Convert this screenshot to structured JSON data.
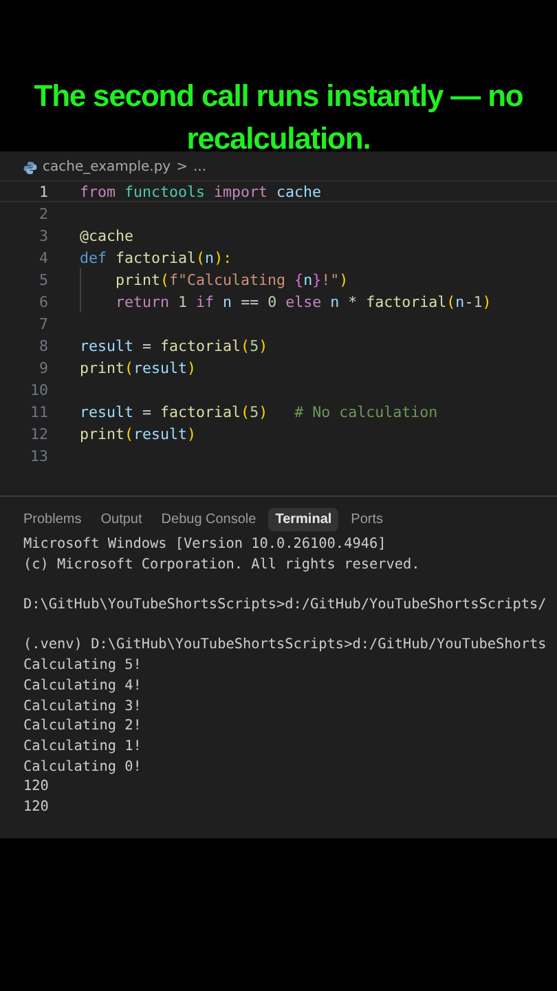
{
  "caption": "The second call runs instantly — no recalculation.",
  "breadcrumb": {
    "file": "cache_example.py",
    "separator": ">",
    "more": "..."
  },
  "editor": {
    "lines": [
      {
        "number": "1",
        "current": true,
        "tokens": [
          {
            "text": "from",
            "kind": "keyword"
          },
          {
            "text": " functools",
            "kind": "module"
          },
          {
            "text": " import",
            "kind": "keyword"
          },
          {
            "text": " cache",
            "kind": "variable"
          }
        ]
      },
      {
        "number": "2",
        "current": false
      },
      {
        "number": "3",
        "current": false,
        "tokens": [
          {
            "text": "@cache",
            "kind": "decorator"
          }
        ]
      },
      {
        "number": "4",
        "current": false,
        "tokens": [
          {
            "text": "def",
            "kind": "storage"
          },
          {
            "text": " factorial",
            "kind": "function"
          },
          {
            "text": "(",
            "kind": "paren"
          },
          {
            "text": "n",
            "kind": "variable"
          },
          {
            "text": "):",
            "kind": "paren"
          }
        ],
        "children": [
          {
            "number": "5",
            "current": false,
            "tokens": [
              {
                "text": "print",
                "kind": "function"
              },
              {
                "text": "(",
                "kind": "paren"
              },
              {
                "text": "f\"Calculating ",
                "kind": "string"
              },
              {
                "text": "{",
                "kind": "paren2"
              },
              {
                "text": "n",
                "kind": "variable"
              },
              {
                "text": "}",
                "kind": "paren2"
              },
              {
                "text": "!\"",
                "kind": "string"
              },
              {
                "text": ")",
                "kind": "paren"
              }
            ]
          },
          {
            "number": "6",
            "current": false,
            "tokens": [
              {
                "text": "return",
                "kind": "keyword"
              },
              {
                "text": " 1",
                "kind": "number"
              },
              {
                "text": " if",
                "kind": "keyword"
              },
              {
                "text": " n",
                "kind": "variable"
              },
              {
                "text": " == "
              },
              {
                "text": "0",
                "kind": "number"
              },
              {
                "text": " else",
                "kind": "keyword"
              },
              {
                "text": " n",
                "kind": "variable"
              },
              {
                "text": " * "
              },
              {
                "text": "factorial",
                "kind": "function"
              },
              {
                "text": "(",
                "kind": "paren"
              },
              {
                "text": "n",
                "kind": "variable"
              },
              {
                "text": "-"
              },
              {
                "text": "1",
                "kind": "number"
              },
              {
                "text": ")",
                "kind": "paren"
              }
            ]
          }
        ]
      },
      {
        "number": "7",
        "current": false
      },
      {
        "number": "8",
        "current": false,
        "tokens": [
          {
            "text": "result",
            "kind": "variable"
          },
          {
            "text": " = "
          },
          {
            "text": "factorial",
            "kind": "function"
          },
          {
            "text": "(",
            "kind": "paren"
          },
          {
            "text": "5",
            "kind": "number"
          },
          {
            "text": ")",
            "kind": "paren"
          }
        ]
      },
      {
        "number": "9",
        "current": false,
        "tokens": [
          {
            "text": "print",
            "kind": "function"
          },
          {
            "text": "(",
            "kind": "paren"
          },
          {
            "text": "result",
            "kind": "variable"
          },
          {
            "text": ")",
            "kind": "paren"
          }
        ]
      },
      {
        "number": "10",
        "current": false
      },
      {
        "number": "11",
        "current": false,
        "tokens": [
          {
            "text": "result",
            "kind": "variable"
          },
          {
            "text": " = "
          },
          {
            "text": "factorial",
            "kind": "function"
          },
          {
            "text": "(",
            "kind": "paren"
          },
          {
            "text": "5",
            "kind": "number"
          },
          {
            "text": ")",
            "kind": "paren"
          },
          {
            "text": "   # No calculation",
            "kind": "comment"
          }
        ]
      },
      {
        "number": "12",
        "current": false,
        "tokens": [
          {
            "text": "print",
            "kind": "function"
          },
          {
            "text": "(",
            "kind": "paren"
          },
          {
            "text": "result",
            "kind": "variable"
          },
          {
            "text": ")",
            "kind": "paren"
          }
        ]
      },
      {
        "number": "13",
        "current": false
      }
    ]
  },
  "panel": {
    "tabs": [
      {
        "label": "Problems",
        "selected": false
      },
      {
        "label": "Output",
        "selected": false
      },
      {
        "label": "Debug Console",
        "selected": false
      },
      {
        "label": "Terminal",
        "selected": true
      },
      {
        "label": "Ports",
        "selected": false
      }
    ],
    "terminal": {
      "blocks": [
        [
          "Microsoft Windows [Version 10.0.26100.4946]",
          "(c) Microsoft Corporation. All rights reserved."
        ],
        [
          "D:\\GitHub\\YouTubeShortsScripts>d:/GitHub/YouTubeShortsScripts/"
        ],
        [
          "(.venv) D:\\GitHub\\YouTubeShortsScripts>d:/GitHub/YouTubeShorts",
          "Calculating 5!",
          "Calculating 4!",
          "Calculating 3!",
          "Calculating 2!",
          "Calculating 1!",
          "Calculating 0!",
          "120",
          "120"
        ]
      ]
    }
  }
}
